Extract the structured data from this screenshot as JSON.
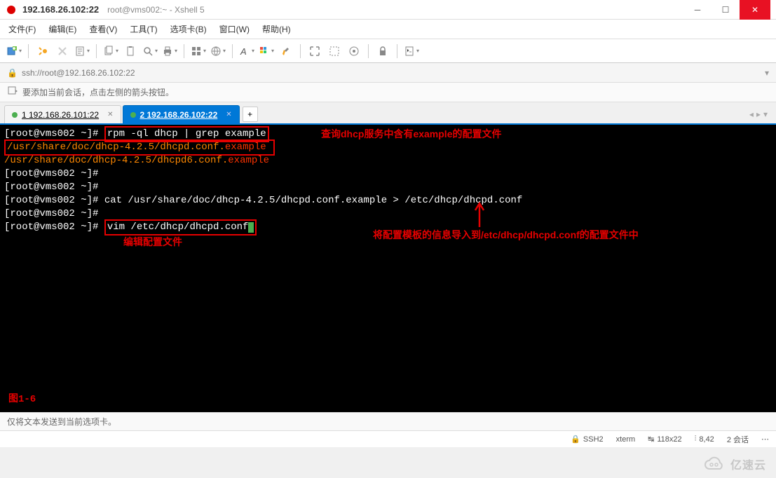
{
  "titlebar": {
    "ip": "192.168.26.102:22",
    "path": "root@vms002:~ - Xshell 5"
  },
  "menu": {
    "file": "文件(F)",
    "edit": "编辑(E)",
    "view": "查看(V)",
    "tools": "工具(T)",
    "tabs": "选项卡(B)",
    "window": "窗口(W)",
    "help": "帮助(H)"
  },
  "address": {
    "url": "ssh://root@192.168.26.102:22"
  },
  "hint": {
    "text": "要添加当前会话，点击左侧的箭头按钮。"
  },
  "tabs": {
    "tab1": "1 192.168.26.101:22",
    "tab2": "2 192.168.26.102:22"
  },
  "terminal": {
    "line1_prompt": "[root@vms002 ~]# ",
    "line1_cmd": "rpm -ql dhcp | grep example",
    "annotation1": "查询dhcp服务中含有example的配置文件",
    "line2_a": "/usr/share/doc/dhcp-4.2.5/dhcpd.conf.",
    "line2_b": "example",
    "line3_a": "/usr/share/doc/dhcp-4.2.5/dhcpd6.conf.",
    "line3_b": "example",
    "line4": "[root@vms002 ~]#",
    "line5": "[root@vms002 ~]#",
    "line6": "[root@vms002 ~]# cat /usr/share/doc/dhcp-4.2.5/dhcpd.conf.example > /etc/dhcp/dhcpd.conf",
    "line7": "[root@vms002 ~]#",
    "line8_prompt": "[root@vms002 ~]# ",
    "line8_cmd": "vim /etc/dhcp/dhcpd.conf",
    "annotation2": "编辑配置文件",
    "annotation3": "将配置模板的信息导入到/etc/dhcp/dhcpd.conf的配置文件中",
    "fig_label": "图1-6"
  },
  "commandbar": {
    "text": "仅将文本发送到当前选项卡。"
  },
  "status": {
    "ssh": "SSH2",
    "term": "xterm",
    "size": "118x22",
    "pos": "8,42",
    "sessions": "2 会话"
  },
  "watermark": "亿速云"
}
